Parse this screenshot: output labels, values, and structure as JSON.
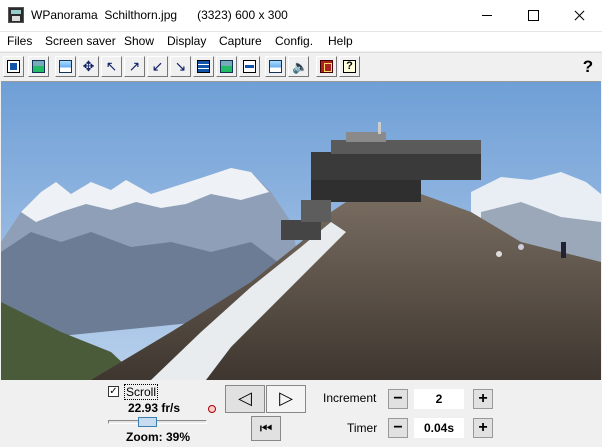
{
  "window": {
    "title": "WPanorama  Schilthorn.jpg      (3323) 600 x 300"
  },
  "menu": [
    "Files",
    "Screen saver",
    "Show",
    "Display",
    "Capture",
    "Config.",
    "Help"
  ],
  "toolbar": {
    "buttons": [
      "open-file-icon",
      "image-icon",
      "fit-icon",
      "move-icon",
      "shrink-left-icon",
      "expand-right-icon",
      "shrink-down-icon",
      "expand-down-icon",
      "panorama-small-icon",
      "panorama-large-icon",
      "flat-icon",
      "landscape-icon",
      "speaker-icon",
      "book-icon",
      "help-icon"
    ],
    "help_label": "?"
  },
  "controls": {
    "scroll_checked": "✓",
    "scroll_label": "Scroll",
    "speed": "22.93 fr/s",
    "zoom": "Zoom: 39%",
    "zoom_fraction": 0.39,
    "prev_glyph": "◁",
    "next_glyph": "▷",
    "first_glyph": "⏮",
    "increment_label": "Increment",
    "increment_value": "2",
    "timer_label": "Timer",
    "timer_value": "0.04s",
    "minus": "−",
    "plus": "+"
  },
  "colors": {
    "sky": "#8fb4de",
    "accent": "#3c7fb1"
  }
}
